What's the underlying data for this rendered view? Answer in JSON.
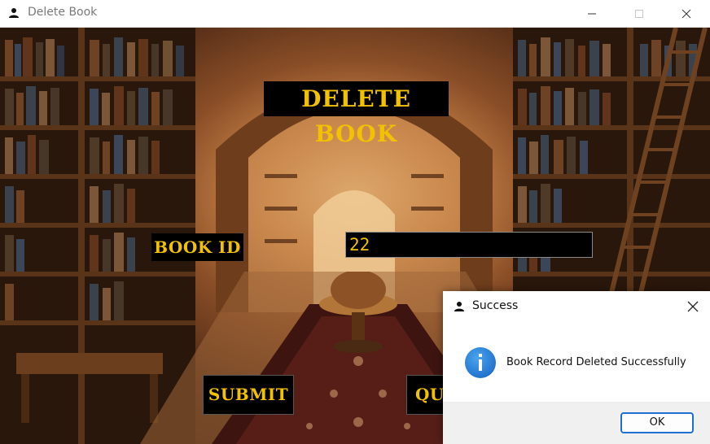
{
  "window": {
    "title": "Delete Book"
  },
  "form": {
    "heading": "DELETE BOOK",
    "book_id_label": "BOOK ID",
    "book_id_value": "22",
    "submit_label": "SUBMIT",
    "quit_label": "QUI"
  },
  "dialog": {
    "title": "Success",
    "message": "Book Record Deleted Successfully",
    "ok_label": "OK",
    "icon": "info-icon"
  },
  "colors": {
    "accent_text": "#f2c200",
    "label_background": "#000000",
    "dialog_button_border": "#1f6fd1",
    "info_icon": "#1e7fd8"
  }
}
